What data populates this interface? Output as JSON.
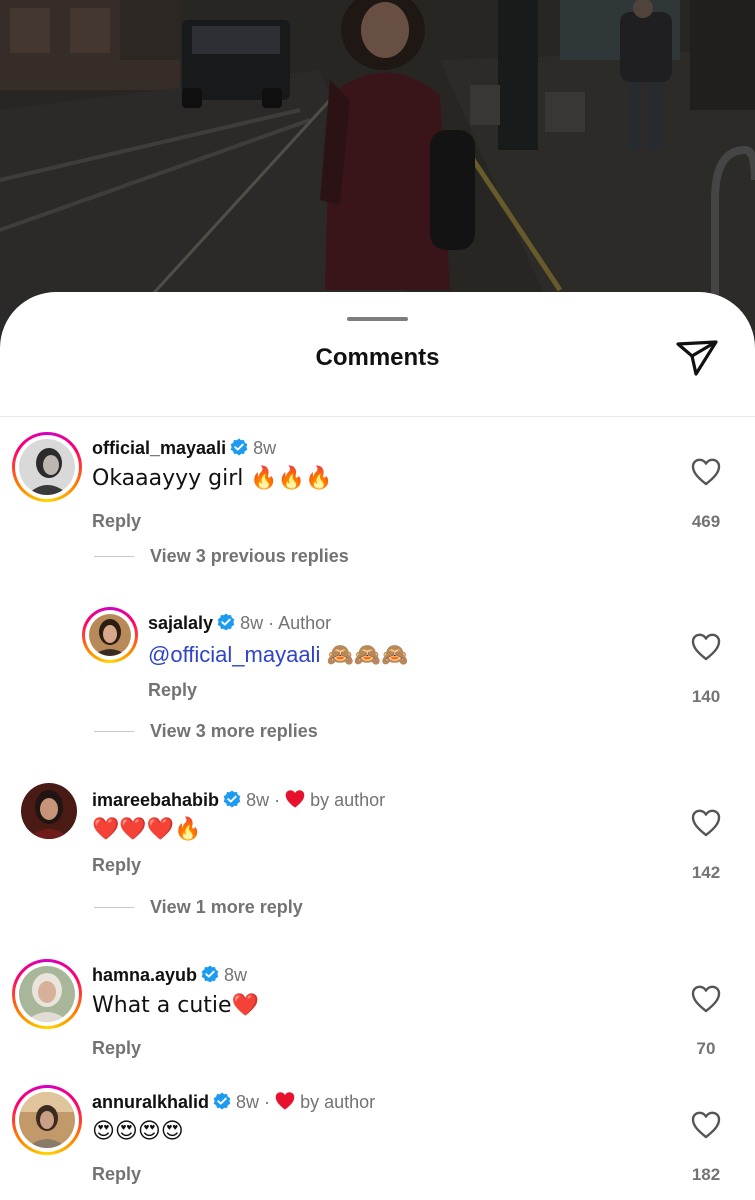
{
  "sheet": {
    "title": "Comments",
    "share_icon": "send-paper-plane-icon"
  },
  "colors": {
    "mention": "#2f44c9",
    "verified": "#1d9bf0",
    "heart": "#e8112d",
    "muted": "#737373"
  },
  "comments": [
    {
      "username": "official_mayaali",
      "verified": true,
      "age": "8w",
      "author_tag": "",
      "liked_by_author": false,
      "text": "Okaaayyy girl 🔥🔥🔥",
      "reply_label": "Reply",
      "likes": "469",
      "view_replies": "View 3 previous replies"
    },
    {
      "username": "sajalaly",
      "verified": true,
      "age": "8w",
      "author_tag": "· Author",
      "liked_by_author": false,
      "mention": "@official_mayaali",
      "text": "🙈🙈🙈",
      "reply_label": "Reply",
      "likes": "140",
      "view_replies": "View 3 more replies"
    },
    {
      "username": "imareebahabib",
      "verified": true,
      "age": "8w ·",
      "author_tag": "by author",
      "liked_by_author": true,
      "text": "❤️❤️❤️🔥",
      "reply_label": "Reply",
      "likes": "142",
      "view_replies": "View 1 more reply"
    },
    {
      "username": "hamna.ayub",
      "verified": true,
      "age": "8w",
      "author_tag": "",
      "liked_by_author": false,
      "text": "What a cutie❤️",
      "reply_label": "Reply",
      "likes": "70"
    },
    {
      "username": "annuralkhalid",
      "verified": true,
      "age": "8w ·",
      "author_tag": "by author",
      "liked_by_author": true,
      "text": "😍😍😍😍",
      "reply_label": "Reply",
      "likes": "182"
    }
  ]
}
